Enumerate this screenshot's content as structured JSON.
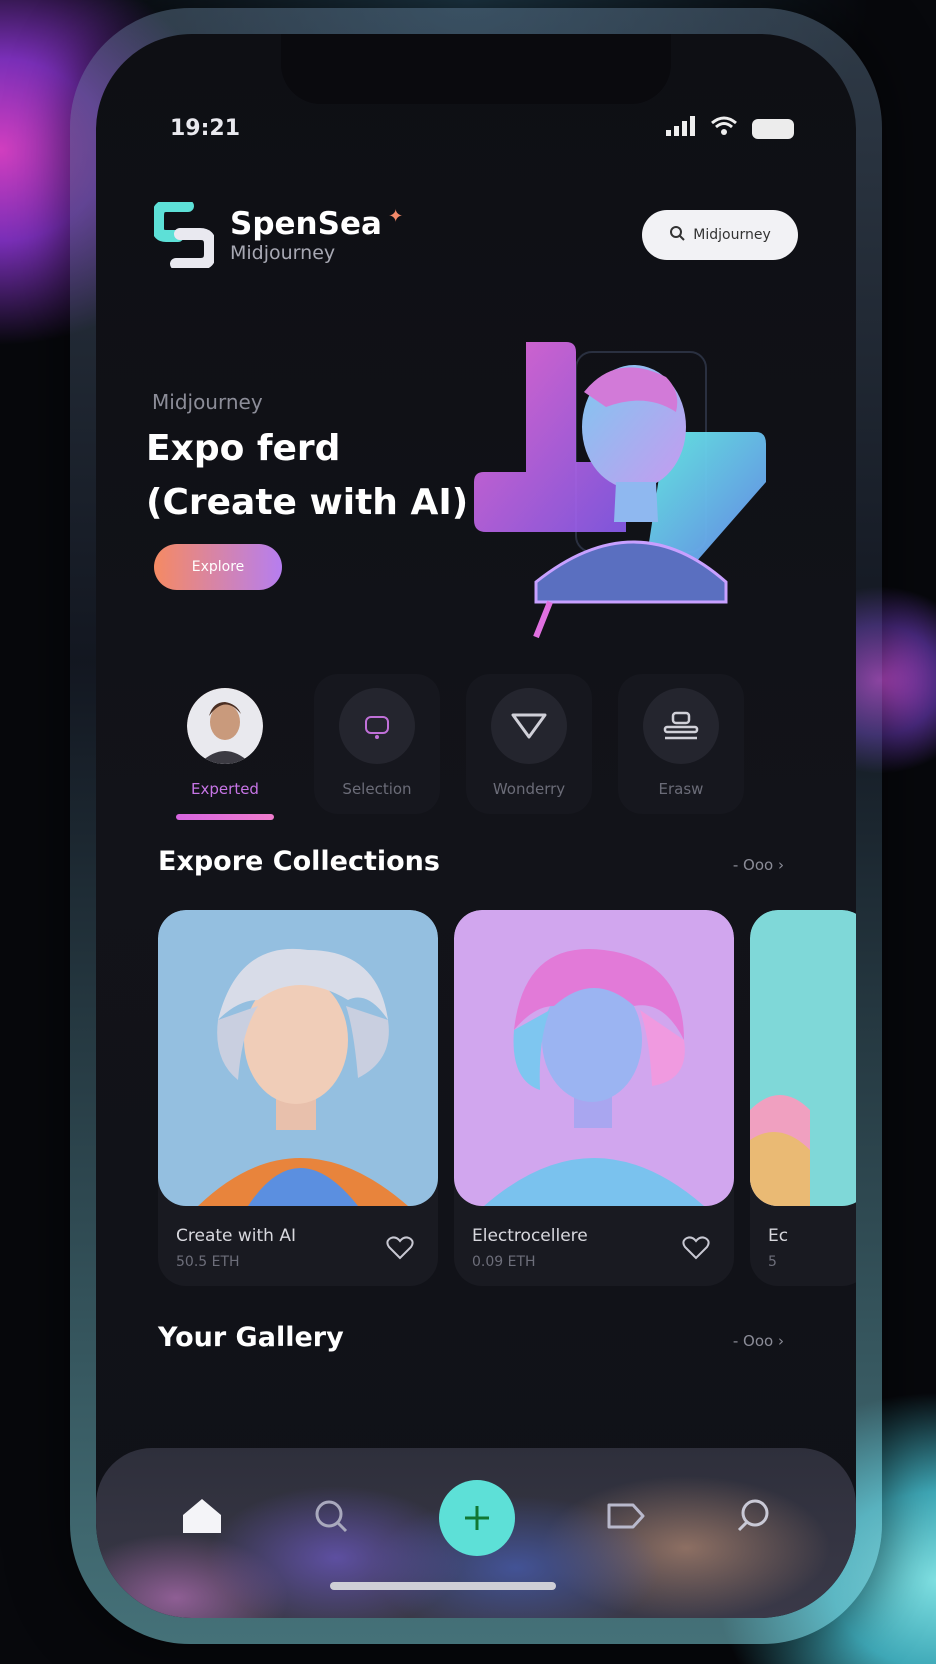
{
  "status": {
    "time": "19:21"
  },
  "brand": {
    "name": "SpenSea",
    "subtitle": "Midjourney"
  },
  "search": {
    "placeholder": "Midjourney"
  },
  "hero": {
    "kicker": "Midjourney",
    "title_line1": "Expo ferd",
    "title_line2": "(Create with AI)",
    "button": "Explore"
  },
  "categories": [
    {
      "label": "Experted",
      "active": true
    },
    {
      "label": "Selection",
      "active": false
    },
    {
      "label": "Wonderry",
      "active": false
    },
    {
      "label": "Erasw",
      "active": false
    }
  ],
  "collections": {
    "title": "Expore Collections",
    "more": "- Ooo",
    "cards": [
      {
        "title": "Create with AI",
        "sub": "50.5 ETH"
      },
      {
        "title": "Electrocellere",
        "sub": "0.09 ETH"
      },
      {
        "title": "Ec",
        "sub": "5"
      }
    ]
  },
  "gallery": {
    "title": "Your Gallery",
    "more": "- Ooo"
  },
  "colors": {
    "accent_teal": "#5de0d7",
    "accent_pink": "#d765e0",
    "accent_orange": "#f58a63"
  },
  "nav": {
    "items": [
      "home-icon",
      "search-icon",
      "add-icon",
      "tag-icon",
      "chat-icon"
    ]
  }
}
